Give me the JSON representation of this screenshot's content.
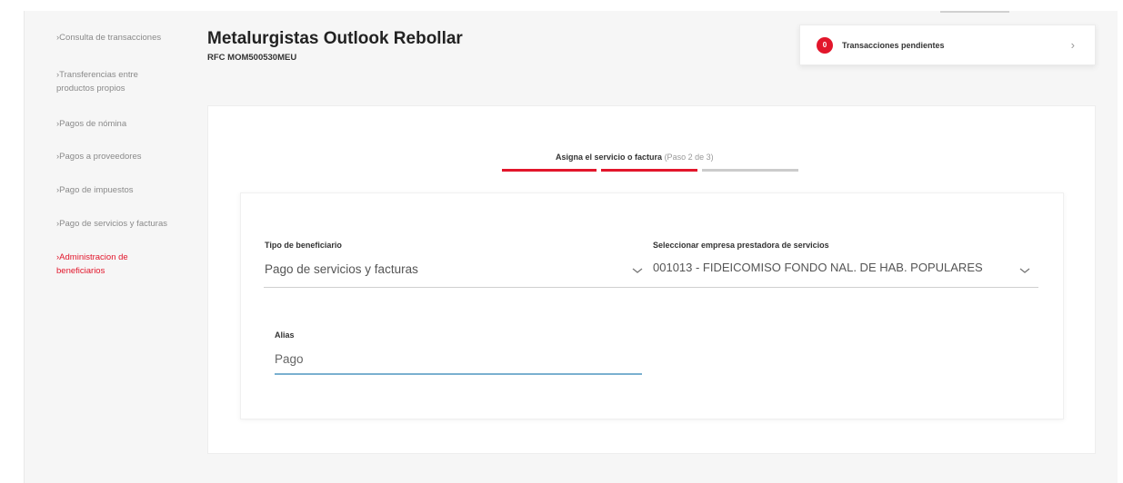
{
  "sidebar": {
    "items": [
      {
        "label": "Consulta de transacciones",
        "active": false
      },
      {
        "label": "Transferencias entre productos propios",
        "active": false
      },
      {
        "label": "Pagos de nómina",
        "active": false
      },
      {
        "label": "Pagos a proveedores",
        "active": false
      },
      {
        "label": "Pago de impuestos",
        "active": false
      },
      {
        "label": "Pago de servicios y facturas",
        "active": false
      },
      {
        "label": "Administracion de beneficiarios",
        "active": true
      }
    ]
  },
  "header": {
    "company_name": "Metalurgistas Outlook Rebollar",
    "rfc": "RFC MOM500530MEU"
  },
  "pending": {
    "count": "0",
    "label": "Transacciones pendientes"
  },
  "stepper": {
    "title": "Asigna el servicio o factura",
    "subtitle": "(Paso 2 de 3)",
    "current_step": 2,
    "total_steps": 3
  },
  "form": {
    "beneficiary_type": {
      "label": "Tipo de beneficiario",
      "value": "Pago de servicios y facturas"
    },
    "company": {
      "label": "Seleccionar empresa prestadora de servicios",
      "value": "001013 - FIDEICOMISO FONDO NAL. DE HAB. POPULARES"
    },
    "alias": {
      "label": "Alias",
      "value": "Pago"
    }
  },
  "colors": {
    "accent": "#e2162b",
    "step_inactive": "#cccccc",
    "input_focus": "#7ab0d0"
  }
}
